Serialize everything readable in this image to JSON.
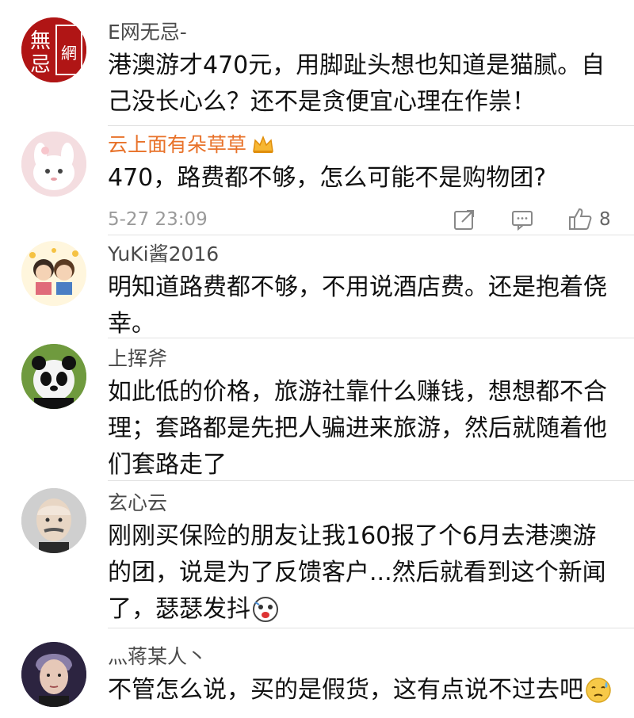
{
  "comments": [
    {
      "user": "E网无忌-",
      "text": "港澳游才470元，用脚趾头想也知道是猫腻。自己没长心么？还不是贪便宜心理在作祟！"
    },
    {
      "user": "云上面有朵草草",
      "text": "470，路费都不够，怎么可能不是购物团?",
      "time": "5-27 23:09",
      "likes": "8"
    },
    {
      "user": "YuKi酱2016",
      "text": "明知道路费都不够，不用说酒店费。还是抱着侥幸。"
    },
    {
      "user": "上挥斧",
      "text": "如此低的价格，旅游社靠什么赚钱，想想都不合理；套路都是先把人骗进来旅游，然后就随着他们套路走了"
    },
    {
      "user": "玄心云",
      "text": "刚刚买保险的朋友让我160报了个6月去港澳游的团，说是为了反馈客户...然后就看到这个新闻了，瑟瑟发抖"
    },
    {
      "user": "灬蒋某人丶",
      "text": "不管怎么说，买的是假货，这有点说不过去吧"
    }
  ],
  "avatar_badges": {
    "c0_top": "無",
    "c0_bottom": "忌",
    "c0_side": "網"
  },
  "icons": {
    "repost": "repost-icon",
    "comment": "comment-icon",
    "like": "thumbs-up-icon",
    "crown": "crown-icon",
    "scared": "scared-emoji-icon",
    "sweat": "sweat-emoji-icon"
  },
  "colors": {
    "vip_name": "#e8722a",
    "meta": "#9a9a9a",
    "divider": "#e2e2e2"
  }
}
